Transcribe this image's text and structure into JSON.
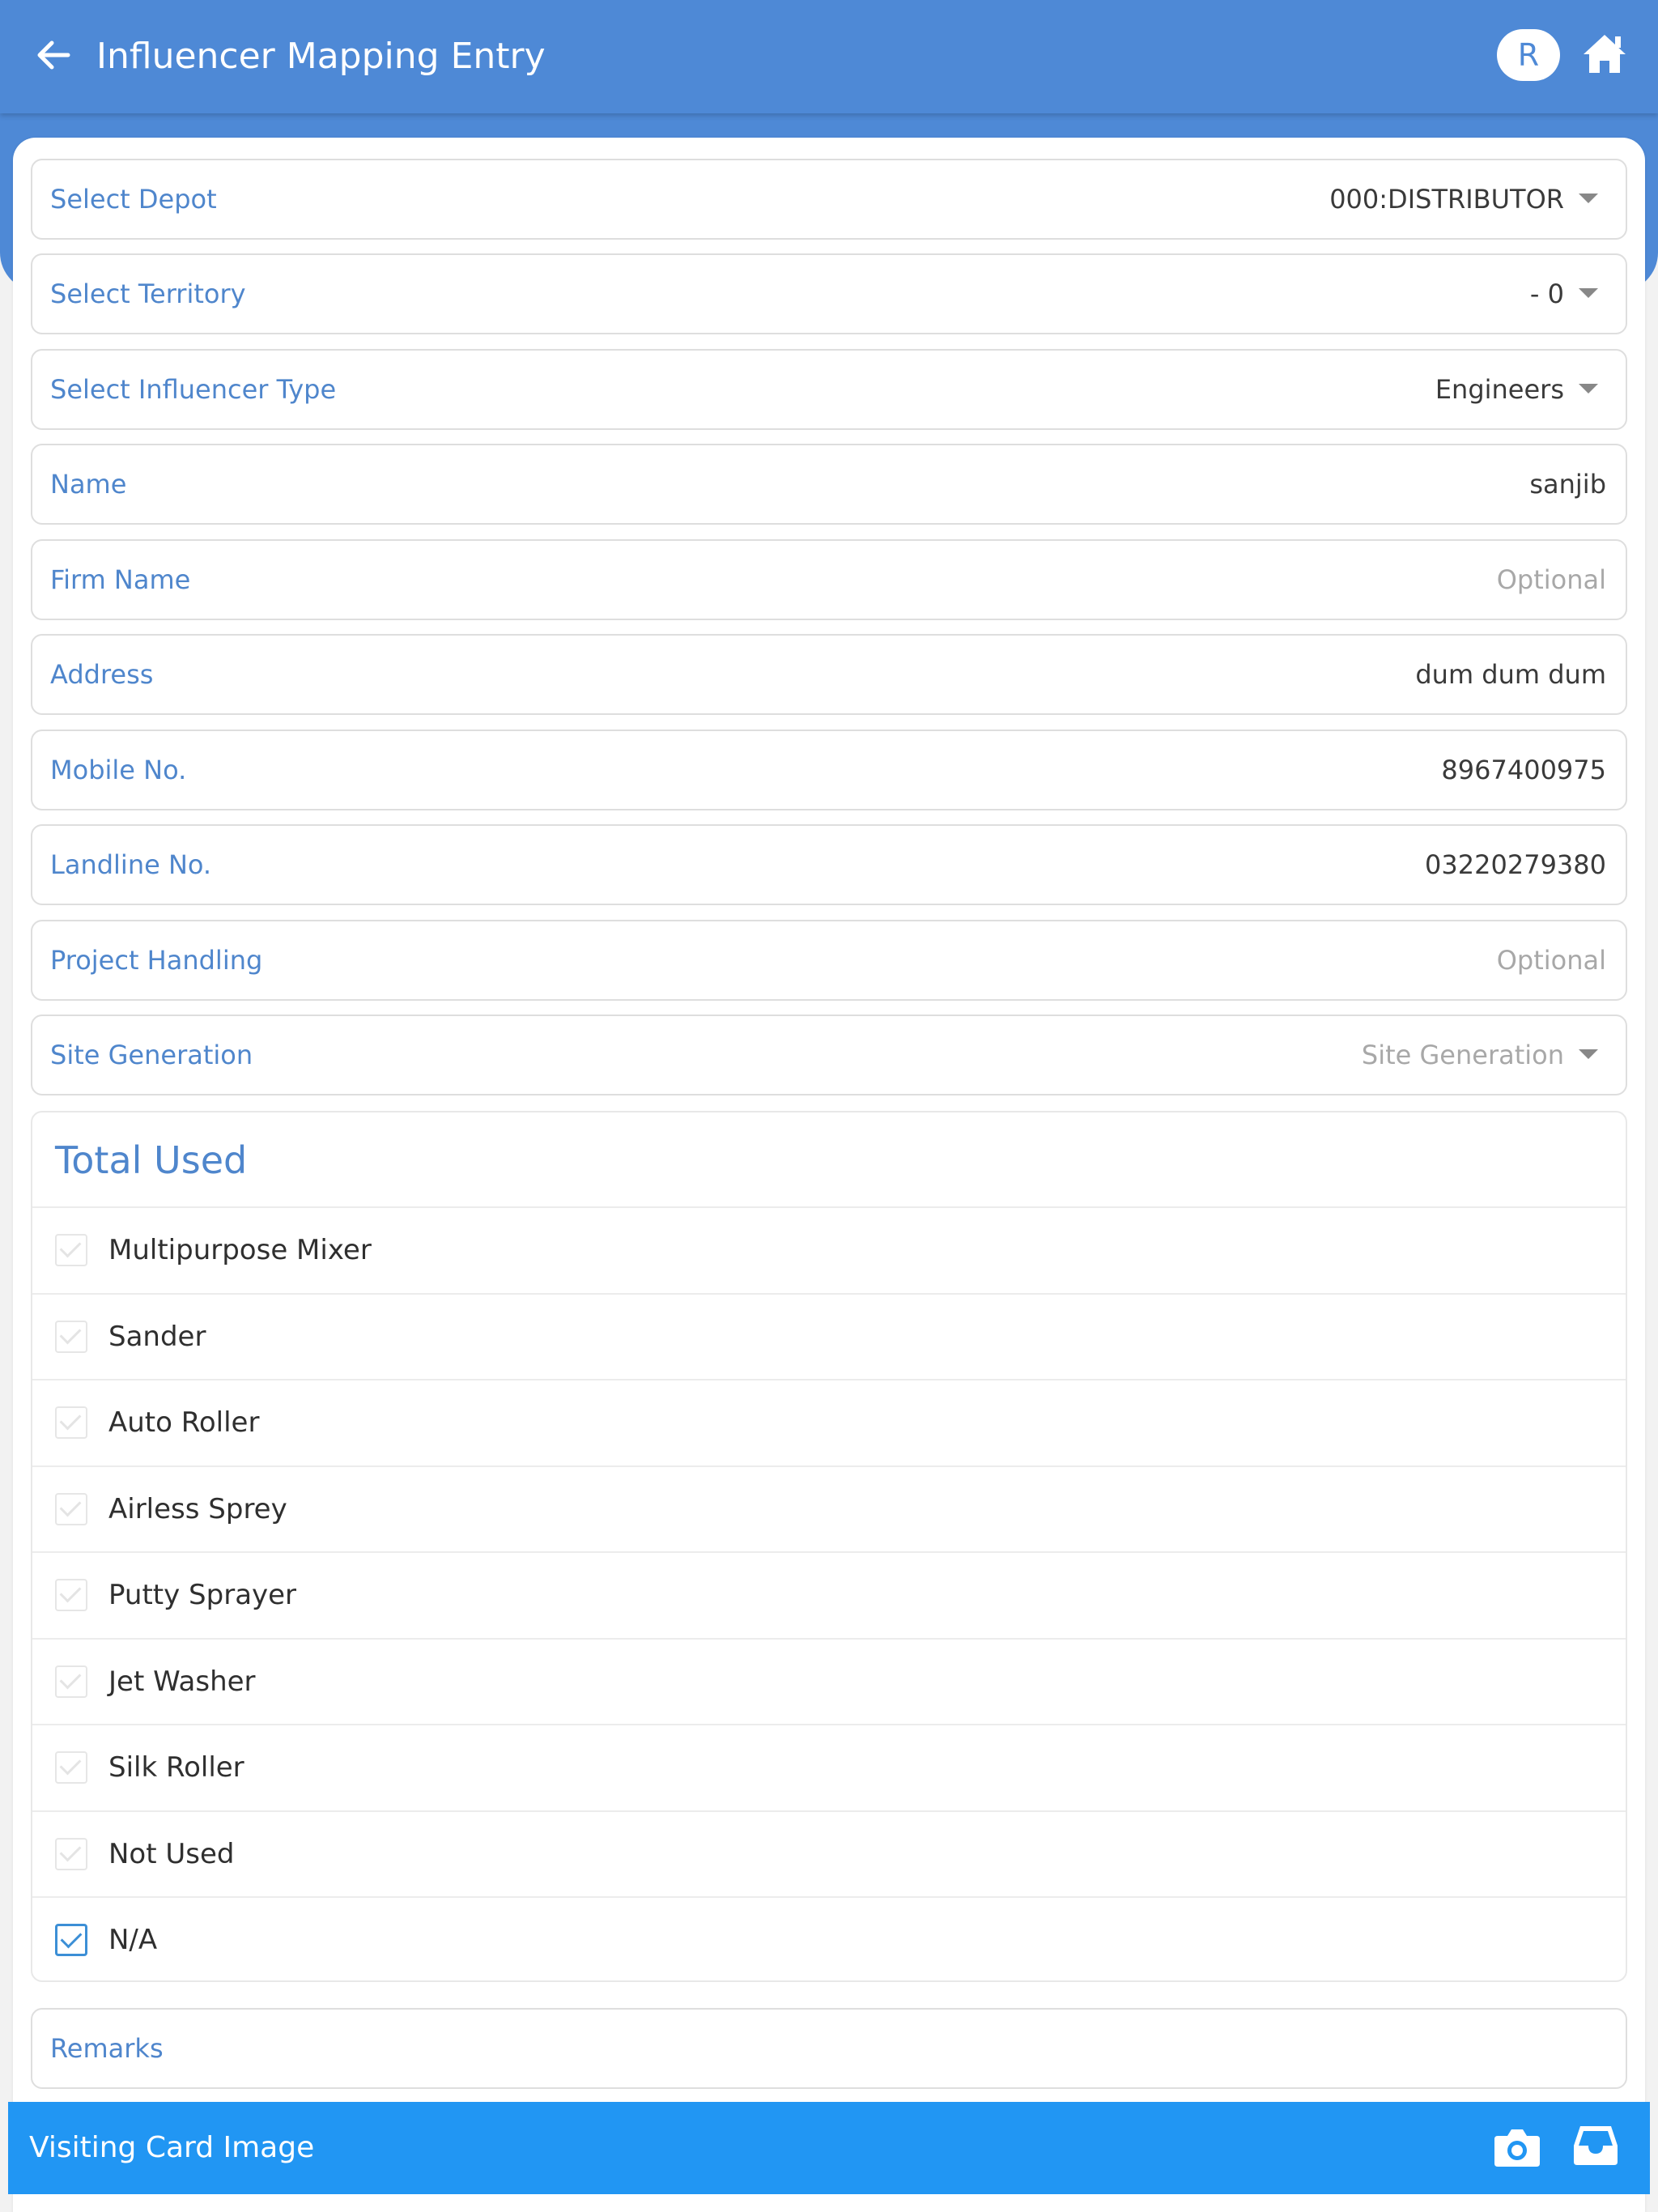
{
  "header": {
    "title": "Influencer Mapping Entry",
    "avatar_letter": "R",
    "back_icon": "arrow-left-icon",
    "home_icon": "home-icon",
    "bg_color": "#4e89d6"
  },
  "fields": [
    {
      "label": "Select Depot",
      "value": "000:DISTRIBUTOR",
      "type": "dropdown"
    },
    {
      "label": "Select Territory",
      "value": "- 0",
      "type": "dropdown"
    },
    {
      "label": "Select Influencer Type",
      "value": "Engineers",
      "type": "dropdown"
    },
    {
      "label": "Name",
      "value": "sanjib",
      "type": "text"
    },
    {
      "label": "Firm Name",
      "placeholder": "Optional",
      "type": "text"
    },
    {
      "label": "Address",
      "value": "dum dum dum",
      "type": "text"
    },
    {
      "label": "Mobile No.",
      "value": "8967400975",
      "type": "text"
    },
    {
      "label": "Landline No.",
      "value": "03220279380",
      "type": "text"
    },
    {
      "label": "Project Handling",
      "placeholder": "Optional",
      "type": "text"
    },
    {
      "label": "Site Generation",
      "placeholder": "Site Generation",
      "type": "dropdown"
    }
  ],
  "total_used": {
    "title": "Total Used",
    "items": [
      {
        "label": "Multipurpose Mixer",
        "checked": false
      },
      {
        "label": "Sander",
        "checked": false
      },
      {
        "label": "Auto Roller",
        "checked": false
      },
      {
        "label": "Airless Sprey",
        "checked": false
      },
      {
        "label": "Putty Sprayer",
        "checked": false
      },
      {
        "label": "Jet Washer",
        "checked": false
      },
      {
        "label": "Silk Roller",
        "checked": false
      },
      {
        "label": "Not Used",
        "checked": false
      },
      {
        "label": "N/A",
        "checked": true
      }
    ]
  },
  "remarks": {
    "label": "Remarks"
  },
  "visiting_card": {
    "label": "Visiting Card Image",
    "camera_icon": "camera-icon",
    "inbox_icon": "inbox-icon",
    "bg_color": "#2196f3"
  }
}
